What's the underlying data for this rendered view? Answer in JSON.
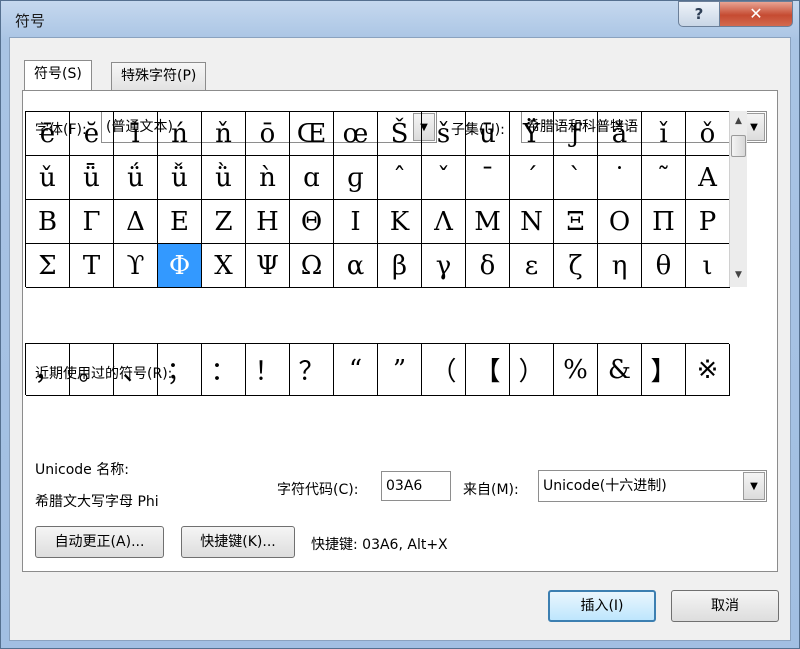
{
  "window": {
    "title": "符号",
    "help_label": "?",
    "close_label": "✕"
  },
  "tabs": [
    {
      "label": "符号(S)",
      "active": true
    },
    {
      "label": "特殊字符(P)",
      "active": false
    }
  ],
  "font": {
    "label": "字体(F):",
    "value": "(普通文本)"
  },
  "subset": {
    "label": "子集(U):",
    "value": "希腊语和科普特语"
  },
  "symbols": [
    "ē",
    "ĕ",
    "ī",
    "ń",
    "ň",
    "ō",
    "Œ",
    "œ",
    "Š",
    "š",
    "ū",
    "Ÿ",
    "ƒ",
    "ǎ",
    "ǐ",
    "ǒ",
    "ǔ",
    "ǖ",
    "ǘ",
    "ǚ",
    "ǜ",
    "ǹ",
    "ɑ",
    "ɡ",
    "ˆ",
    "ˇ",
    "ˉ",
    "ˊ",
    "ˋ",
    "˙",
    "˜",
    "Α",
    "Β",
    "Γ",
    "Δ",
    "Ε",
    "Ζ",
    "Η",
    "Θ",
    "Ι",
    "Κ",
    "Λ",
    "Μ",
    "Ν",
    "Ξ",
    "Ο",
    "Π",
    "Ρ",
    "Σ",
    "Τ",
    "ϒ",
    "Φ",
    "Χ",
    "Ψ",
    "Ω",
    "α",
    "β",
    "γ",
    "δ",
    "ε",
    "ζ",
    "η",
    "θ",
    "ι"
  ],
  "selected_index": 51,
  "recent": {
    "label": "近期使用过的符号(R):",
    "symbols": [
      "，",
      "。",
      "、",
      "；",
      "：",
      "！",
      "？",
      "“",
      "”",
      "（",
      "【",
      "）",
      "%",
      "&",
      "】",
      "※"
    ]
  },
  "unicode_name": {
    "label": "Unicode 名称:",
    "value": "希腊文大写字母 Phi"
  },
  "char_code": {
    "label": "字符代码(C):",
    "value": "03A6"
  },
  "from": {
    "label": "来自(M):",
    "value": "Unicode(十六进制)"
  },
  "buttons": {
    "autocorrect": "自动更正(A)...",
    "shortcut_key": "快捷键(K)...",
    "shortcut_text": "快捷键: 03A6, Alt+X",
    "insert": "插入(I)",
    "cancel": "取消"
  },
  "scroll": {
    "up": "▲",
    "down": "▼"
  },
  "combo_arrow": "▼"
}
